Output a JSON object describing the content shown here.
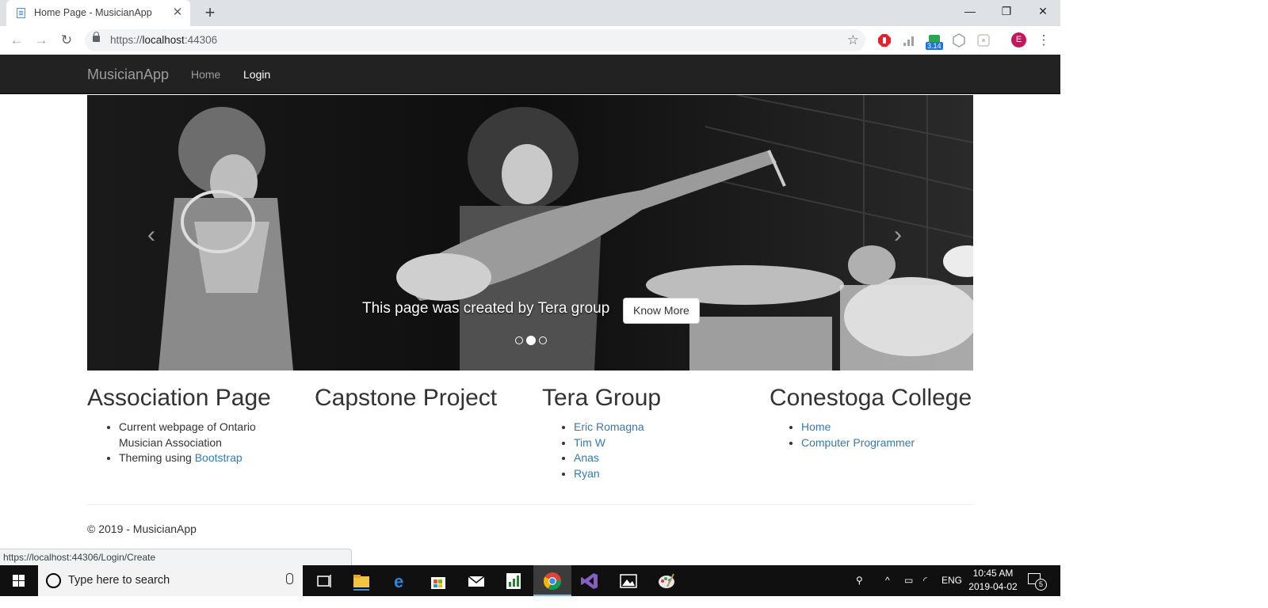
{
  "browser": {
    "tab_title": "Home Page - MusicianApp",
    "tab_close": "✕",
    "new_tab": "+",
    "window_controls": {
      "minimize": "—",
      "restore": "❐",
      "close": "✕"
    },
    "url_prefix": "https://",
    "url_host": "localhost",
    "url_port": ":44306",
    "bookmark_star": "☆",
    "profile_initial": "E",
    "extension_badge": "3.14"
  },
  "navbar": {
    "brand": "MusicianApp",
    "links": [
      {
        "label": "Home",
        "active": false
      },
      {
        "label": "Login",
        "active": true
      }
    ]
  },
  "carousel": {
    "caption": "This page was created by Tera group",
    "button": "Know More",
    "prev": "‹",
    "next": "›",
    "slide_count": 3,
    "active_slide": 2
  },
  "columns": [
    {
      "heading": "Association Page",
      "items": [
        {
          "text": "Current webpage of Ontario Musician Association"
        },
        {
          "text": "Theming using ",
          "link": "Bootstrap"
        }
      ]
    },
    {
      "heading": "Capstone Project",
      "items": []
    },
    {
      "heading": "Tera Group",
      "links": [
        "Eric Romagna",
        "Tim W",
        "Anas",
        "Ryan"
      ]
    },
    {
      "heading": "Conestoga College",
      "links": [
        "Home",
        "Computer Programmer"
      ]
    }
  ],
  "footer": "© 2019 - MusicianApp",
  "status_url": "https://localhost:44306/Login/Create",
  "taskbar": {
    "search_placeholder": "Type here to search",
    "language": "ENG",
    "time": "10:45 AM",
    "date": "2019-04-02",
    "notification_count": "5"
  }
}
